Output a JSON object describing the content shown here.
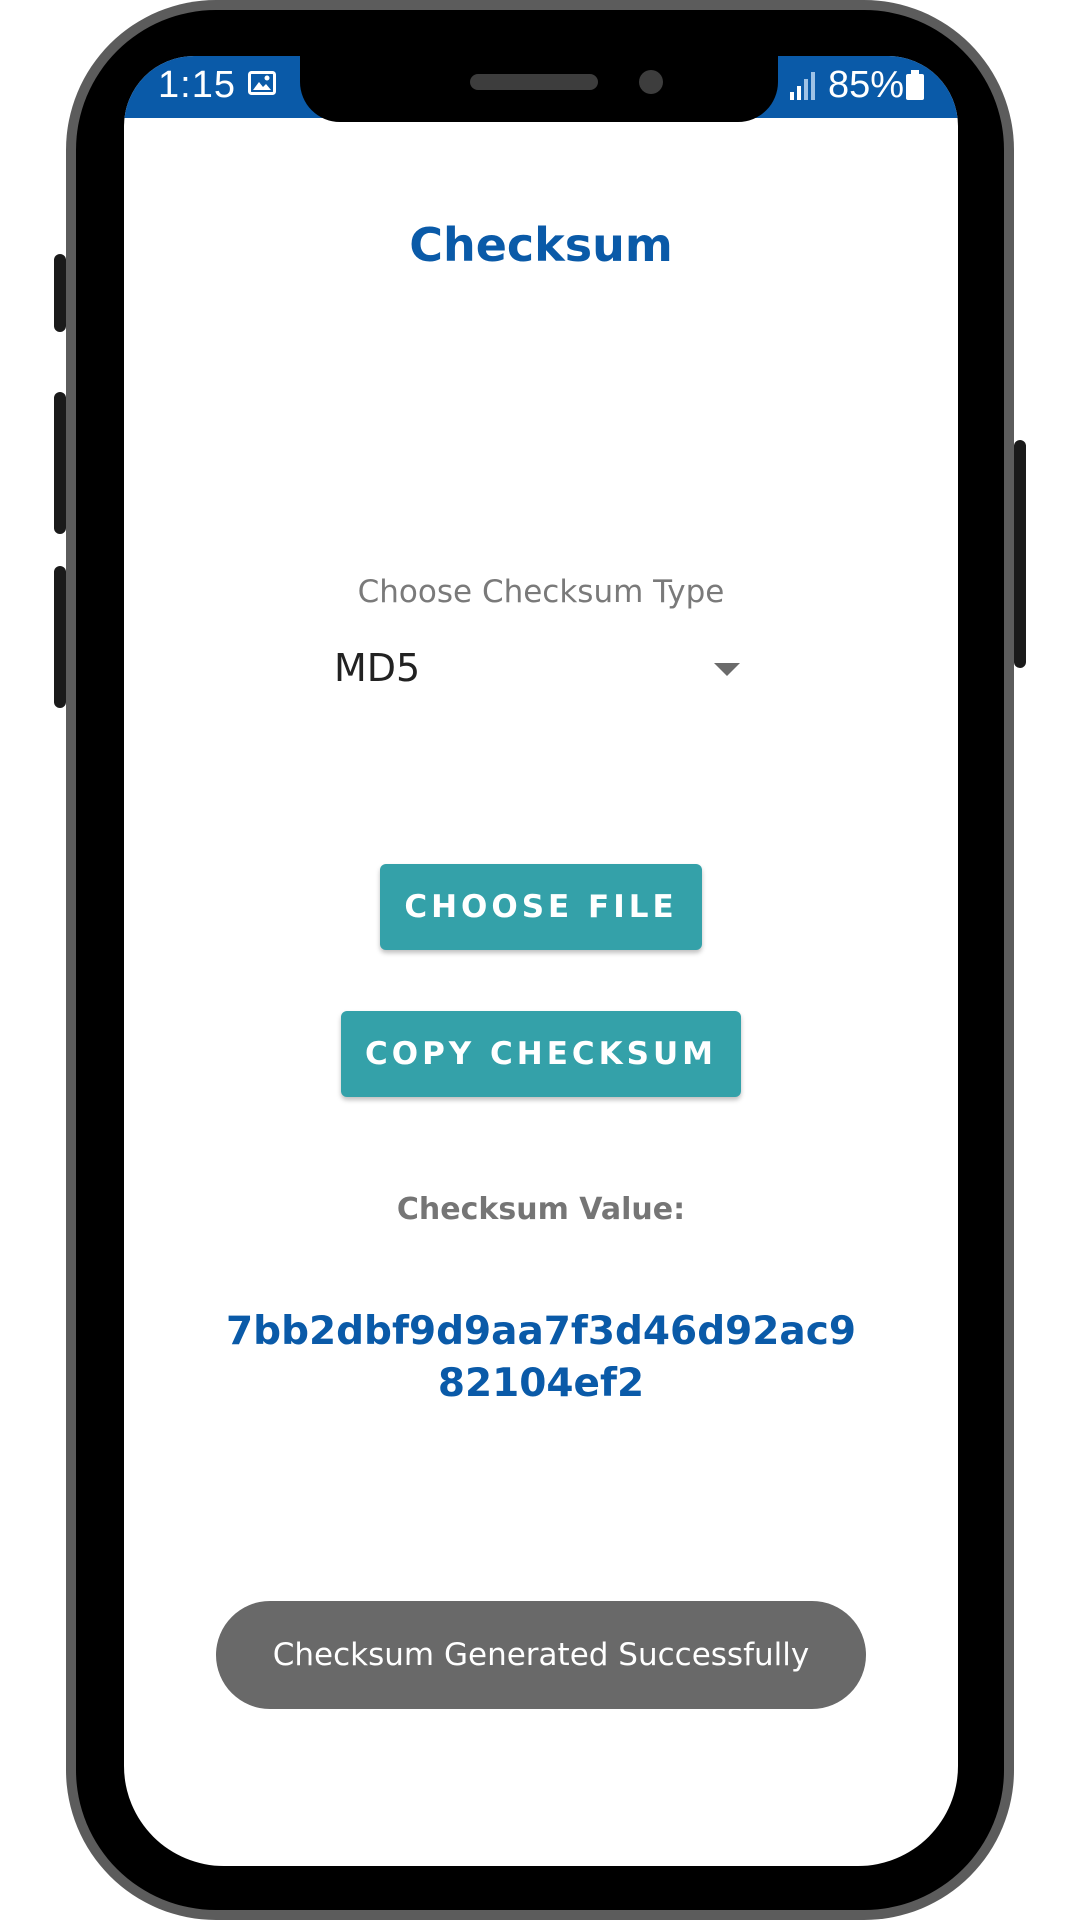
{
  "status_bar": {
    "time": "1:15",
    "battery": "85%",
    "bg_color": "#0a5aa8",
    "icons": [
      "image-icon",
      "signal-icon",
      "battery-icon"
    ]
  },
  "app": {
    "title": "Checksum",
    "type_label": "Choose Checksum Type",
    "selected_type": "MD5",
    "choose_file_button": "CHOOSE FILE",
    "copy_checksum_button": "COPY CHECKSUM",
    "value_label": "Checksum Value:",
    "checksum_value": "7bb2dbf9d9aa7f3d46d92ac982104ef2",
    "toast": "Checksum Generated Successfully",
    "accent_color": "#0a5aa8",
    "button_color": "#34a1a9"
  }
}
